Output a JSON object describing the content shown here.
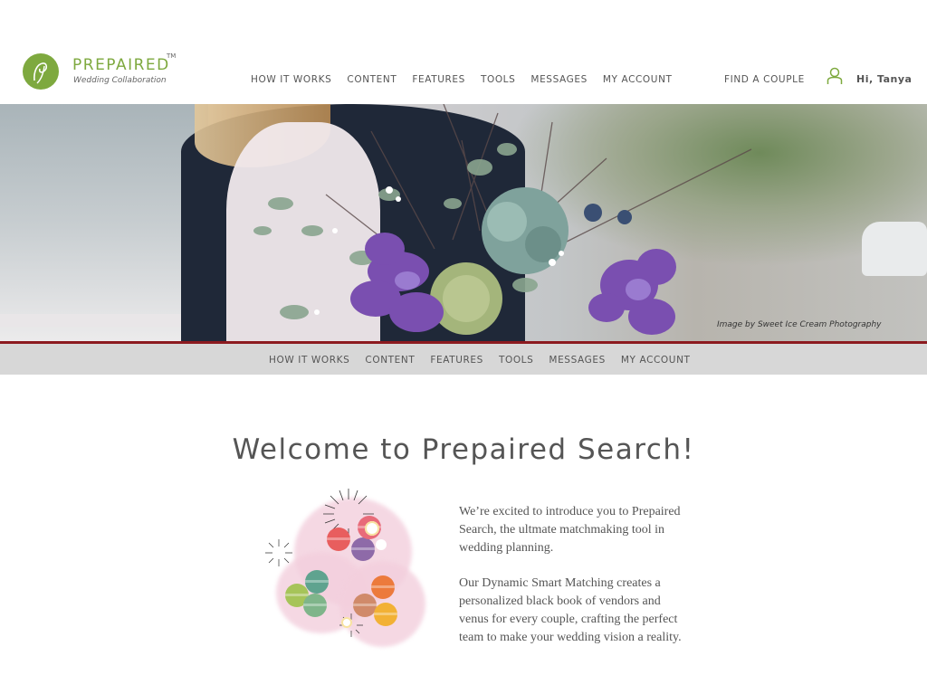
{
  "brand": {
    "name": "PREPAIRED",
    "tm": "TM",
    "tagline": "Wedding Collaboration",
    "logo_color": "#7ea93f"
  },
  "top_nav": {
    "items": [
      "HOW IT WORKS",
      "CONTENT",
      "FEATURES",
      "TOOLS",
      "MESSAGES",
      "MY ACCOUNT"
    ],
    "find_couple": "FIND A COUPLE",
    "user_icon": "user-icon",
    "greeting": "Hi, Tanya"
  },
  "hero": {
    "credit": "Image by Sweet Ice Cream Photography",
    "border_color": "#8c1a1f"
  },
  "sub_nav": {
    "items": [
      "HOW IT WORKS",
      "CONTENT",
      "FEATURES",
      "TOOLS",
      "MESSAGES",
      "MY ACCOUNT"
    ]
  },
  "main": {
    "title": "Welcome to Prepaired Search!",
    "paragraphs": [
      "We’re excited to introduce you to Prepaired Search, the ultmate matchmaking tool in wedding planning.",
      "Our Dynamic Smart Matching creates a personalized black book of vendors and venus for every couple, crafting the perfect team to make your wedding vision a reality."
    ]
  }
}
